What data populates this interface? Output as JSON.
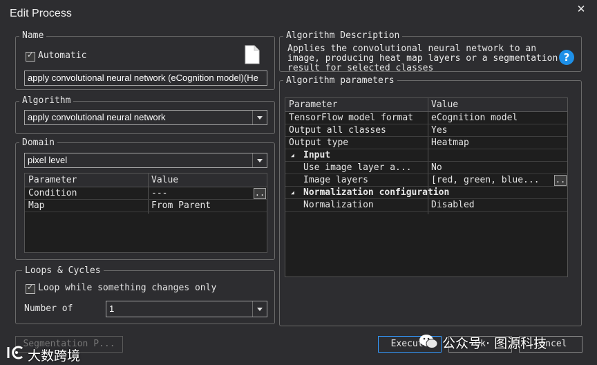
{
  "window": {
    "title": "Edit Process",
    "close_glyph": "✕"
  },
  "name_group": {
    "legend": "Name",
    "automatic_label": "Automatic",
    "automatic_checked": true,
    "name_value": "apply convolutional neural network (eCognition model)(He"
  },
  "algorithm_group": {
    "legend": "Algorithm",
    "selected": "apply convolutional neural network"
  },
  "domain_group": {
    "legend": "Domain",
    "selected": "pixel level",
    "headers": [
      "Parameter",
      "Value"
    ],
    "rows": [
      {
        "param": "Condition",
        "value": "---"
      },
      {
        "param": "Map",
        "value": "From Parent"
      }
    ],
    "ellipsis": ".."
  },
  "loops_group": {
    "legend": "Loops & Cycles",
    "loop_label": "Loop while something changes only",
    "loop_checked": true,
    "number_label": "Number of",
    "number_value": "1"
  },
  "description_group": {
    "legend": "Algorithm Description",
    "text": "Applies the convolutional neural network to an image, producing heat map layers or a segmentation result for selected classes",
    "help_glyph": "?"
  },
  "params_group": {
    "legend": "Algorithm parameters",
    "headers": [
      "Parameter",
      "Value"
    ],
    "rows": [
      {
        "param": "TensorFlow model format",
        "value": "eCognition model",
        "kind": "item",
        "indent": 0
      },
      {
        "param": "Output all classes",
        "value": "Yes",
        "kind": "item",
        "indent": 0
      },
      {
        "param": "Output type",
        "value": "Heatmap",
        "kind": "item",
        "indent": 0
      },
      {
        "param": "Input",
        "value": "",
        "kind": "section",
        "indent": 0
      },
      {
        "param": "Use image layer a...",
        "value": "No",
        "kind": "item",
        "indent": 1
      },
      {
        "param": "Image layers",
        "value": "[red, green, blue...",
        "kind": "item",
        "indent": 1,
        "ellipsis": ".."
      },
      {
        "param": "Normalization configuration",
        "value": "",
        "kind": "section",
        "indent": 0
      },
      {
        "param": "Normalization",
        "value": "Disabled",
        "kind": "item",
        "indent": 1
      }
    ],
    "expand_glyph": "◢"
  },
  "buttons": {
    "segmentation": "Segmentation P...",
    "execute": "Execute",
    "ok": "Ok",
    "cancel": "Cancel"
  },
  "watermarks": {
    "left": "大数跨境",
    "right": "公众号 · 图源科技"
  }
}
